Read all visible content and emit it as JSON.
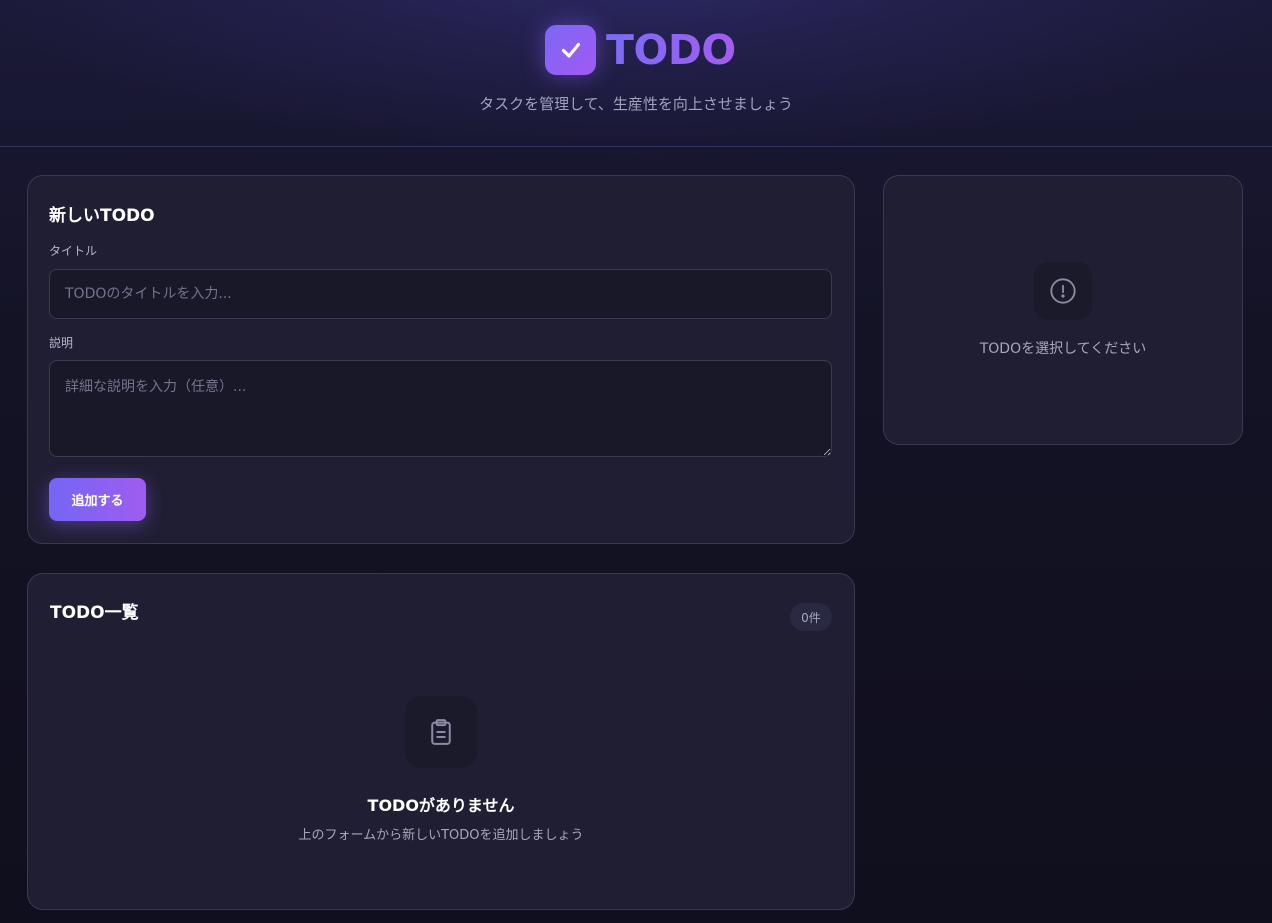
{
  "header": {
    "app_name": "TODO",
    "tagline": "タスクを管理して、生産性を向上させましょう"
  },
  "form": {
    "title": "新しいTODO",
    "title_label": "タイトル",
    "title_placeholder": "TODOのタイトルを入力...",
    "title_value": "",
    "description_label": "説明",
    "description_placeholder": "詳細な説明を入力（任意）...",
    "description_value": "",
    "submit_label": "追加する"
  },
  "detail": {
    "empty_message": "TODOを選択してください",
    "icon": "alert-circle-icon"
  },
  "list": {
    "title": "TODO一覧",
    "count_badge": "0件",
    "empty_title": "TODOがありません",
    "empty_subtitle": "上のフォームから新しいTODOを追加しましょう",
    "icon": "clipboard-icon"
  },
  "colors": {
    "accent_start": "#7466f5",
    "accent_end": "#a05cef",
    "background": "#121122",
    "card": "#201e33"
  }
}
